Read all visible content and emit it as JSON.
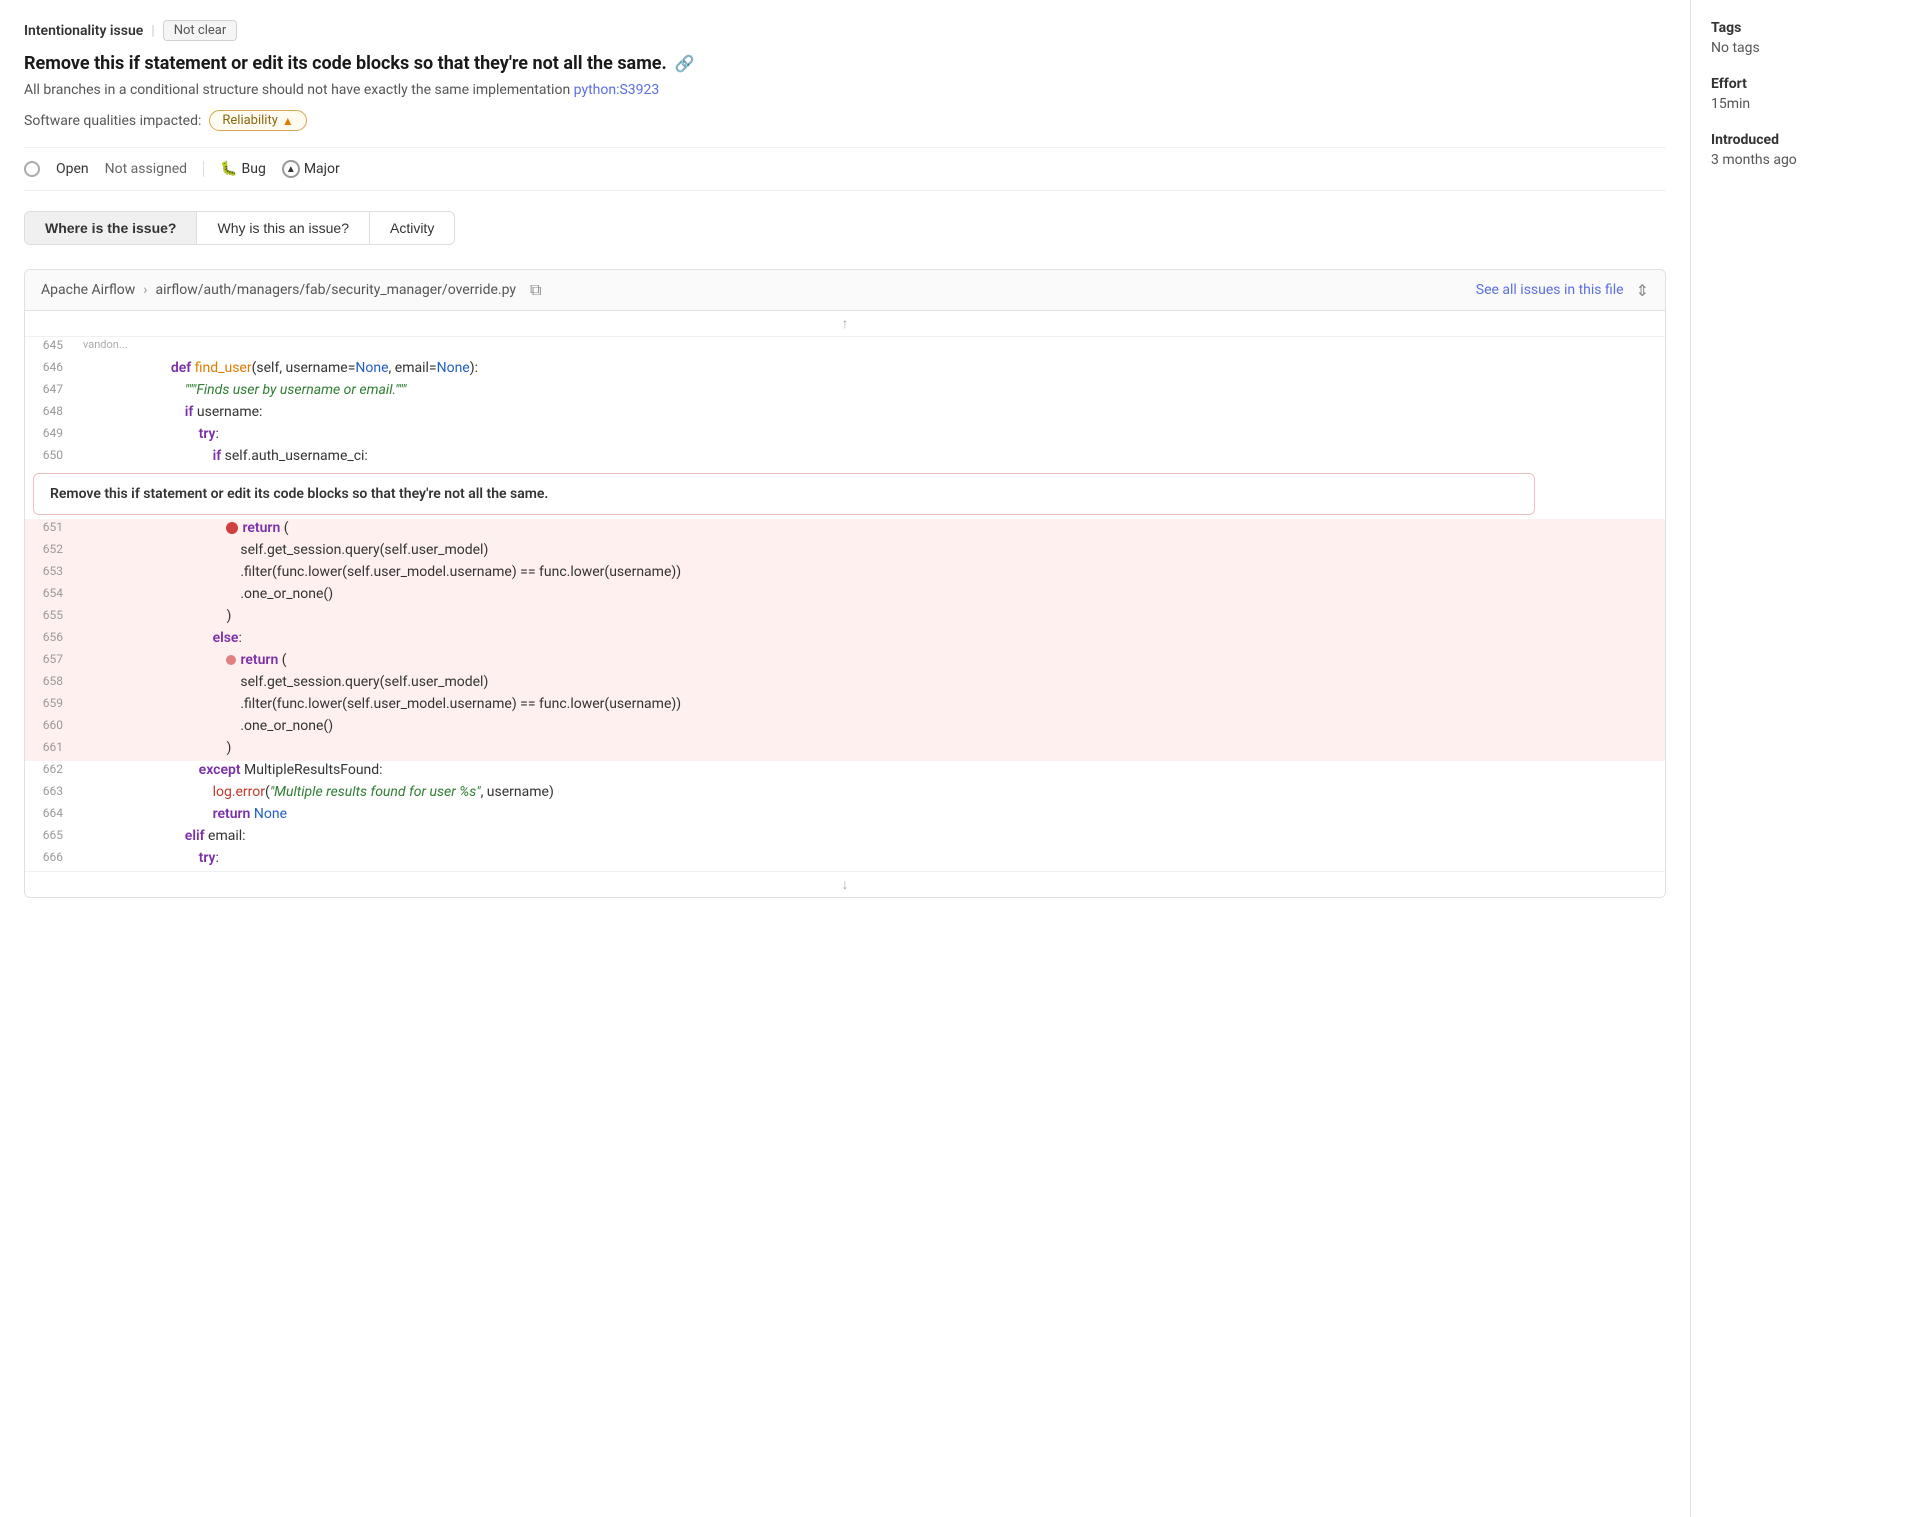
{
  "header": {
    "issue_type": "Intentionality issue",
    "status": "Not clear",
    "title": "Remove this if statement or edit its code blocks so that they're not all the same.",
    "description": "All branches in a conditional structure should not have exactly the same implementation",
    "rule_link": "python:S3923",
    "qualities_label": "Software qualities impacted:",
    "quality_badge": "Reliability",
    "open_label": "Open",
    "not_assigned_label": "Not assigned",
    "bug_label": "Bug",
    "major_label": "Major"
  },
  "tabs": {
    "tab1": "Where is the issue?",
    "tab2": "Why is this an issue?",
    "tab3": "Activity"
  },
  "code_viewer": {
    "project": "Apache Airflow",
    "file_path": "airflow/auth/managers/fab/security_manager/override.py",
    "see_all_link": "See all issues in this file"
  },
  "sidebar": {
    "tags_title": "Tags",
    "tags_value": "No tags",
    "effort_title": "Effort",
    "effort_value": "15min",
    "introduced_title": "Introduced",
    "introduced_value": "3 months ago"
  },
  "code_lines": [
    {
      "num": "645",
      "author": "vandon...",
      "marker": false,
      "content": ""
    },
    {
      "num": "646",
      "author": "",
      "marker": true,
      "content": "    def find_user(self, username=None, email=None):"
    },
    {
      "num": "647",
      "author": "",
      "marker": false,
      "content": "        \"\"\"Finds user by username or email.\"\"\""
    },
    {
      "num": "648",
      "author": "",
      "marker": false,
      "content": "        if username:"
    },
    {
      "num": "649",
      "author": "",
      "marker": false,
      "content": "            try:"
    },
    {
      "num": "650",
      "author": "",
      "marker": false,
      "content": "                if self.auth_username_ci:"
    },
    {
      "num": "651",
      "author": "",
      "marker": false,
      "highlighted": true,
      "content_html": "<span class='dot-marker'></span><span class='kw-return'>return</span> ("
    },
    {
      "num": "652",
      "author": "",
      "marker": false,
      "highlighted": true,
      "content": "                    self.get_session.query(self.user_model)"
    },
    {
      "num": "653",
      "author": "",
      "marker": false,
      "highlighted": true,
      "content": "                    .filter(func.lower(self.user_model.username) == func.lower(username))"
    },
    {
      "num": "654",
      "author": "",
      "marker": false,
      "highlighted": true,
      "content": "                    .one_or_none()"
    },
    {
      "num": "655",
      "author": "",
      "marker": false,
      "highlighted": true,
      "content": "                )"
    },
    {
      "num": "656",
      "author": "",
      "marker": false,
      "highlighted": true,
      "content_kw": "else:"
    },
    {
      "num": "657",
      "author": "",
      "marker": true,
      "highlighted": true,
      "content_html": "<span class='dot-marker-pink'></span><span class='kw-return'>return</span> ("
    },
    {
      "num": "658",
      "author": "",
      "marker": false,
      "highlighted": true,
      "content": "                    self.get_session.query(self.user_model)"
    },
    {
      "num": "659",
      "author": "",
      "marker": false,
      "highlighted": true,
      "content": "                    .filter(func.lower(self.user_model.username) == func.lower(username))"
    },
    {
      "num": "660",
      "author": "",
      "marker": false,
      "highlighted": true,
      "content": "                    .one_or_none()"
    },
    {
      "num": "661",
      "author": "",
      "marker": false,
      "highlighted": true,
      "content": "                )"
    },
    {
      "num": "662",
      "author": "",
      "marker": false,
      "content": "            except MultipleResultsFound:"
    },
    {
      "num": "663",
      "author": "",
      "marker": false,
      "content": "                log.error(\"Multiple results found for user %s\", username)"
    },
    {
      "num": "664",
      "author": "",
      "marker": false,
      "content": "                return None"
    },
    {
      "num": "665",
      "author": "",
      "marker": false,
      "content": "        elif email:"
    },
    {
      "num": "666",
      "author": "",
      "marker": false,
      "content": "            try:"
    }
  ],
  "issue_popup_text": "Remove this if statement or edit its code blocks so that they're not all the same."
}
